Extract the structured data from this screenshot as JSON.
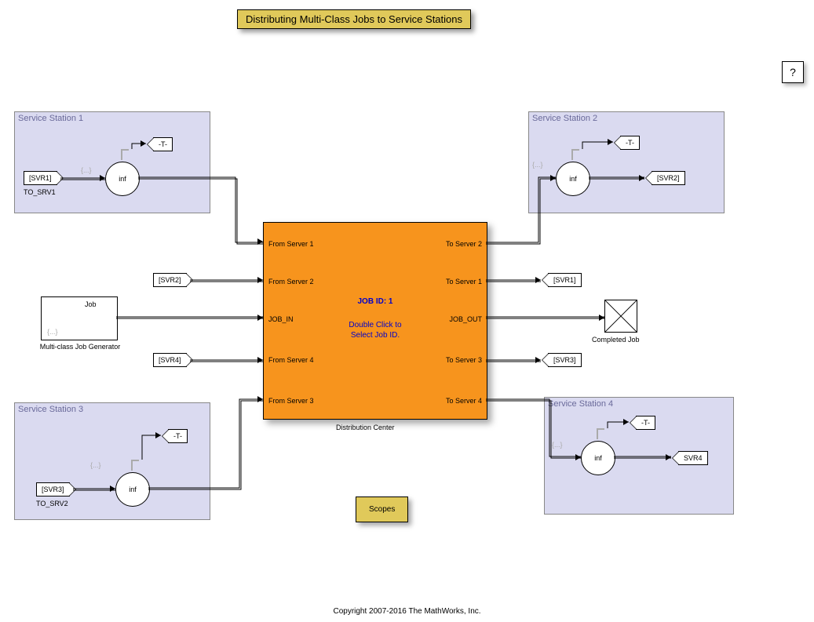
{
  "title": "Distributing Multi-Class Jobs to Service Stations",
  "help": "?",
  "station1": {
    "name": "Service Station 1",
    "tag": "[SVR1]",
    "tagBelow": "TO_SRV1",
    "tTag": "-T-",
    "inf": "inf",
    "curly": "{...}"
  },
  "station2": {
    "name": "Service Station 2",
    "tag": "[SVR2]",
    "tTag": "-T-",
    "inf": "inf",
    "curly": "{...}"
  },
  "station3": {
    "name": "Service Station 3",
    "tag": "[SVR3]",
    "tagBelow": "TO_SRV2",
    "tTag": "-T-",
    "inf": "inf",
    "curly": "{...}"
  },
  "station4": {
    "name": "Service Station 4",
    "tag": "SVR4",
    "tTag": "-T-",
    "inf": "inf",
    "curly": "{...}"
  },
  "generator": {
    "outLabel": "Job",
    "caption": "Multi-class Job Generator",
    "curly": "{...}"
  },
  "svr2tag": "[SVR2]",
  "svr4tag": "[SVR4]",
  "svr1tag_right": "[SVR1]",
  "svr3tag_right": "[SVR3]",
  "center": {
    "caption": "Distribution Center",
    "jobid": "JOB ID: 1",
    "hint1": "Double Click to",
    "hint2": "Select Job ID.",
    "left": {
      "p1": "From Server 1",
      "p2": "From Server 2",
      "pjob": "JOB_IN",
      "p4": "From Server 4",
      "p3": "From Server 3"
    },
    "right": {
      "p2": "To Server 2",
      "p1": "To Server 1",
      "pjob": "JOB_OUT",
      "p3": "To Server 3",
      "p4": "To Server 4"
    }
  },
  "completed": "Completed Job",
  "scopes": "Scopes",
  "copyright": "Copyright 2007-2016 The MathWorks, Inc."
}
